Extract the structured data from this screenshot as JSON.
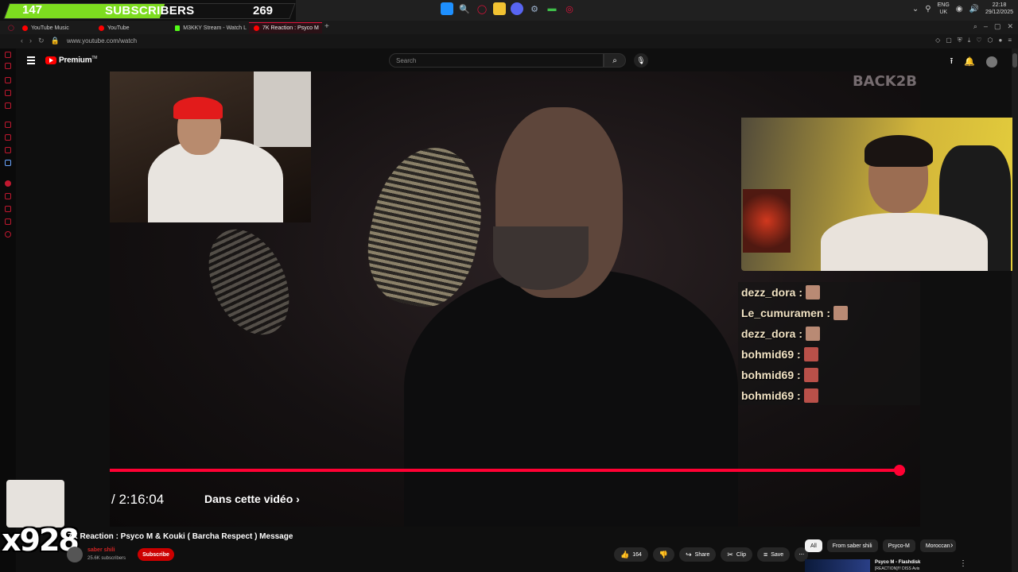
{
  "overlay": {
    "subs_current": "147",
    "subs_label": "SUBSCRIBERS",
    "subs_goal": "269",
    "subs_progress_fraction": 0.546,
    "counter": "x928"
  },
  "taskbar": {
    "apps": [
      "windows-start-icon",
      "search-icon",
      "opera-icon",
      "folder-icon",
      "discord-icon",
      "steam-icon",
      "obs-icon",
      "opera-gx-icon"
    ],
    "lang_top": "ENG",
    "lang_bottom": "UK",
    "time": "22:18",
    "date": "29/12/2025"
  },
  "browser": {
    "tabs": [
      {
        "label": "YouTube Music",
        "color": "#ff0000"
      },
      {
        "label": "YouTube",
        "color": "#ff0000"
      },
      {
        "label": "M3KKY Stream - Watch L",
        "color": "#53fc18"
      },
      {
        "label": "7K Reaction : Psyco M",
        "color": "#ff0000"
      }
    ],
    "url": "www.youtube.com/watch"
  },
  "youtube": {
    "brand": "Premium",
    "brand_sup": "TM",
    "search_placeholder": "Search"
  },
  "chat": [
    {
      "user": "dezz_dora :",
      "emote": "face"
    },
    {
      "user": "Le_cumuramen :",
      "emote": "face"
    },
    {
      "user": "dezz_dora :",
      "emote": "face"
    },
    {
      "user": "bohmid69 :",
      "emote": "red"
    },
    {
      "user": "bohmid69 :",
      "emote": "red"
    },
    {
      "user": "bohmid69 :",
      "emote": "red"
    }
  ],
  "player": {
    "time": "/ 2:16:04",
    "chapters": "Dans cette vidéo",
    "progress_fraction": 0.993
  },
  "video_info": {
    "title": "7K Reaction : Psyco M & Kouki ( Barcha Respect ) Message",
    "channel": "saber shili",
    "subscribers": "25.6K subscribers",
    "subscribe": "Subscribe",
    "likes": "164",
    "share": "Share",
    "clip": "Clip",
    "save": "Save"
  },
  "chips": [
    "All",
    "From saber shili",
    "Psyco-M",
    "Moroccan"
  ],
  "recommendation": {
    "title": "Psyco M - Flashdisk",
    "subtitle": "[REACTION]!!! DISS Avis"
  }
}
